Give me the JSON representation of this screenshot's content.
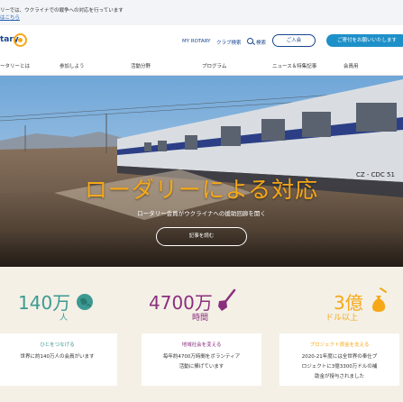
{
  "alert": {
    "line1": "リーでは、ウクライナでの戦争への対応を行っています",
    "line2": "はこちら"
  },
  "header": {
    "brand": "tary",
    "my_rotary": "MY ROTARY",
    "club_search": "クラブ検索",
    "search": "検索",
    "join": "ご入会",
    "donate": "ご寄付をお願いいたします"
  },
  "nav": [
    "ータリーとは",
    "参加しよう",
    "活動分野",
    "プログラム",
    "ニュース＆特集記事",
    "会員用"
  ],
  "hero": {
    "title": "ローダリーによる対応",
    "subtitle": "ロータリー会員がウクライナへの援助回廊を開く",
    "button": "記事を読む",
    "train_text": "CZ - CDC 51"
  },
  "stats": [
    {
      "number": "140万",
      "unit": "人",
      "heading": "ひとをつなげる",
      "text": [
        "世界に約140万人の会員がいます"
      ],
      "color": "#3d9a92",
      "icon": "globe-icon"
    },
    {
      "number": "4700万",
      "unit": "時間",
      "heading": "地域社会を変える",
      "text": [
        "毎年約4700万時間をボランティア",
        "活動に捧げています"
      ],
      "color": "#8a2f7e",
      "icon": "shovel-icon"
    },
    {
      "number": "3億",
      "unit": "ドル以上",
      "heading": "プロジェクト資金を支える",
      "text": [
        "2020-21年度には全世界の奉仕プ",
        "ロジェクトに3億3300万ドルの補",
        "助金が授与されました"
      ],
      "color": "#f6a818",
      "icon": "money-bag-icon"
    }
  ]
}
